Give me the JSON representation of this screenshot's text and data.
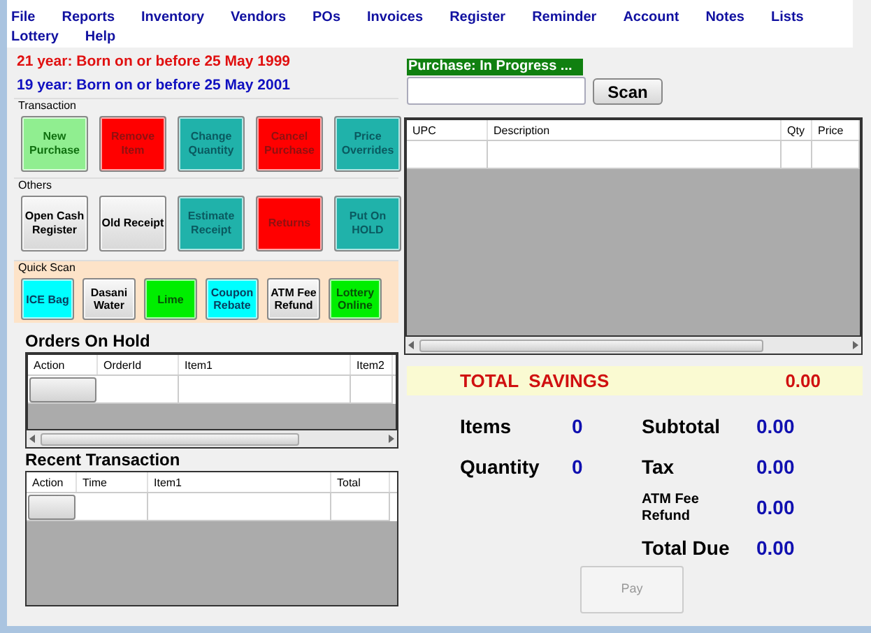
{
  "menu": [
    "File",
    "Reports",
    "Inventory",
    "Vendors",
    "POs",
    "Invoices",
    "Register",
    "Reminder",
    "Account",
    "Notes",
    "Lists",
    "Lottery",
    "Help"
  ],
  "age_notices": [
    {
      "text": "21 year: Born on or before 25 May 1999",
      "color": "#e01010"
    },
    {
      "text": "19 year: Born on or before 25 May 2001",
      "color": "#1010c0"
    }
  ],
  "groups": [
    {
      "title": "Transaction",
      "buttons": [
        {
          "label": "New Purchase",
          "kind": "lightgreen"
        },
        {
          "label": "Remove Item",
          "kind": "red"
        },
        {
          "label": "Change Quantity",
          "kind": "teal"
        },
        {
          "label": "Cancel Purchase",
          "kind": "red"
        },
        {
          "label": "Price Overrides",
          "kind": "teal"
        }
      ]
    },
    {
      "title": "Others",
      "buttons": [
        {
          "label": "Open Cash Register",
          "kind": "gray"
        },
        {
          "label": "Old Receipt",
          "kind": "gray"
        },
        {
          "label": "Estimate Receipt",
          "kind": "teal"
        },
        {
          "label": "Returns",
          "kind": "red"
        },
        {
          "label": "Put On HOLD",
          "kind": "teal"
        }
      ]
    },
    {
      "title": "Quick Scan",
      "buttons": [
        {
          "label": "ICE Bag",
          "kind": "cyan"
        },
        {
          "label": "Dasani Water",
          "kind": "gray"
        },
        {
          "label": "Lime",
          "kind": "green"
        },
        {
          "label": "Coupon Rebate",
          "kind": "cyan"
        },
        {
          "label": "ATM Fee Refund",
          "kind": "gray"
        },
        {
          "label": "Lottery Online",
          "kind": "green"
        }
      ]
    }
  ],
  "orders_on_hold": {
    "title": "Orders On Hold",
    "columns": [
      "Action",
      "OrderId",
      "Item1",
      "Item2"
    ]
  },
  "recent_transaction": {
    "title": "Recent Transaction",
    "columns": [
      "Action",
      "Time",
      "Item1",
      "Total"
    ]
  },
  "purchase_status": "Purchase: In Progress ...",
  "scan_button": "Scan",
  "cart": {
    "columns": [
      "UPC",
      "Description",
      "Qty",
      "Price"
    ]
  },
  "total_savings": {
    "label": "TOTAL  SAVINGS",
    "value": "0.00"
  },
  "counts": [
    {
      "label": "Items",
      "value": "0"
    },
    {
      "label": "Quantity",
      "value": "0"
    }
  ],
  "totals": [
    {
      "label": "Subtotal",
      "value": "0.00",
      "kind": "large"
    },
    {
      "label": "Tax",
      "value": "0.00",
      "kind": "large"
    },
    {
      "label": "ATM Fee Refund",
      "value": "0.00",
      "kind": "small"
    },
    {
      "label": "Total Due",
      "value": "0.00",
      "kind": "large"
    }
  ],
  "pay_button": {
    "label": "Pay",
    "disabled": true
  }
}
